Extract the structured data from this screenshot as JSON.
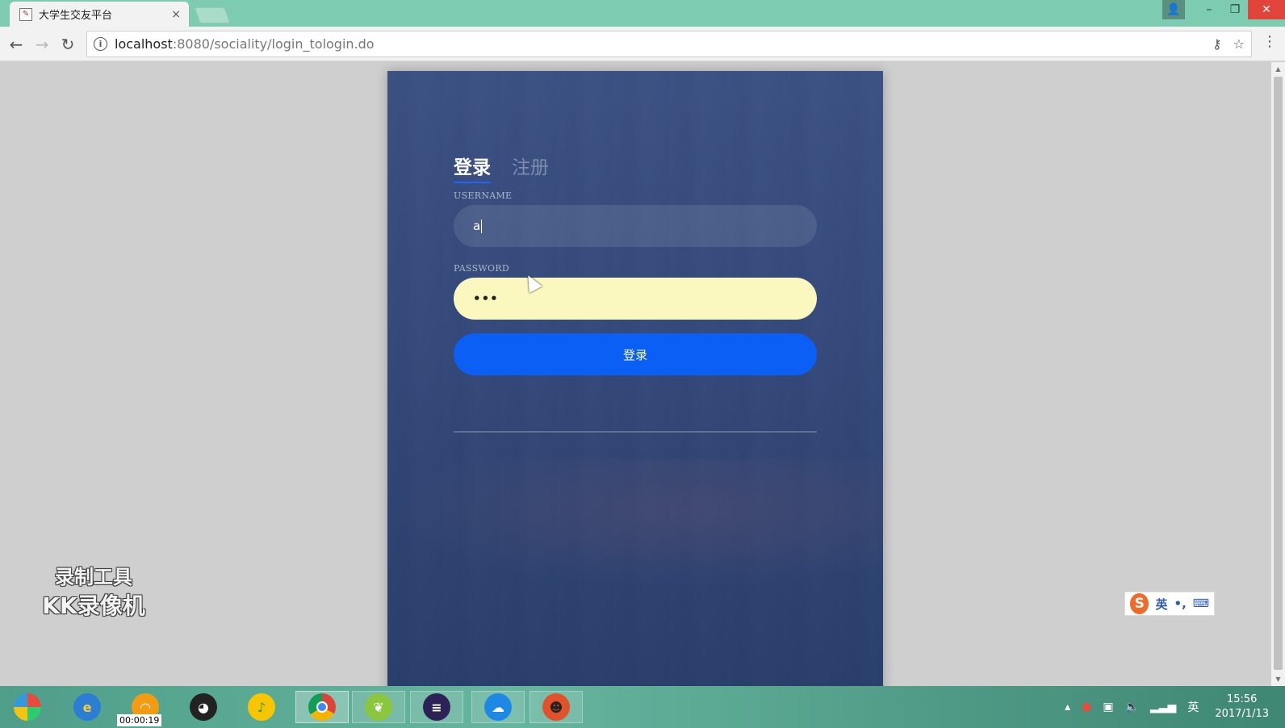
{
  "browser": {
    "tab_title": "大学生交友平台",
    "tab_close": "×",
    "url_host": "localhost",
    "url_path": ":8080/sociality/login_tologin.do",
    "icons": [
      "back-arrow-icon",
      "forward-arrow-icon",
      "reload-icon",
      "info-icon",
      "key-icon",
      "star-icon",
      "menu-icon"
    ]
  },
  "window_controls": {
    "minimize": "–",
    "restore": "❐",
    "close": "✕",
    "user": "👤"
  },
  "login_card": {
    "tab_login": "登录",
    "tab_register": "注册",
    "username_label": "USERNAME",
    "username_value": "a",
    "password_label": "PASSWORD",
    "password_value": "•••",
    "submit_label": "登录",
    "colors": {
      "card_bg": "#3a5082",
      "button": "#0b5ff5",
      "password_bg": "#faf8be"
    }
  },
  "watermark": {
    "line1": "录制工具",
    "line2": "KK录像机"
  },
  "ime": {
    "logo": "S",
    "lang": "英",
    "punct": "•,",
    "kbd": "⌨"
  },
  "taskbar": {
    "icons": [
      "start-orb-icon",
      "ie-browser-icon",
      "wifi-share-icon",
      "qq-penguin-icon",
      "music-player-icon",
      "chrome-icon",
      "app-leaf-icon",
      "eclipse-icon",
      "edge-like-icon",
      "game-character-icon"
    ],
    "record_time": "00:00:19",
    "tray_lang": "英",
    "time": "15:56",
    "date": "2017/1/13"
  }
}
